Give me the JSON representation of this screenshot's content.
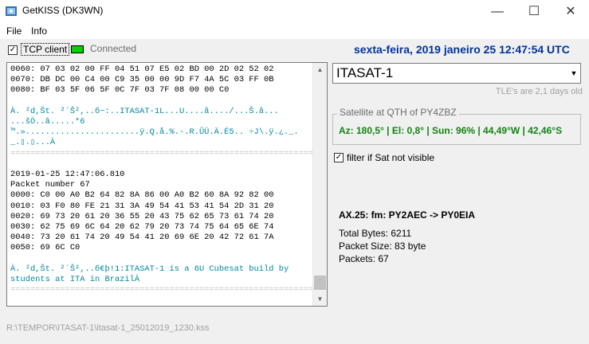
{
  "window": {
    "title": "GetKISS (DK3WN)",
    "minimize": "—",
    "maximize": "☐",
    "close": "✕"
  },
  "menu": {
    "file": "File",
    "info": "Info"
  },
  "connection": {
    "tcp_label": "TCP client",
    "tcp_checked": "✓",
    "status_label": "Connected"
  },
  "clock": "sexta-feira, 2019 janeiro 25  12:47:54 UTC",
  "log": {
    "lines": [
      {
        "t": "0060: 07 03 02 00 FF 04 51 07 E5 02 BD 00 2D 02 52 02",
        "c": ""
      },
      {
        "t": "0070: DB DC 00 C4 00 C9 35 00 00 9D F7 4A 5C 03 FF 0B",
        "c": ""
      },
      {
        "t": "0080: BF 03 5F 06 5F 0C 7F 03 7F 08 00 00 C0",
        "c": ""
      },
      {
        "t": "",
        "c": ""
      },
      {
        "t": "À. ²d,Št. ²`Š²,..б~:..ITASAT-1L...U....â..../...Š.â...",
        "c": "cyan"
      },
      {
        "t": "...šÖ..â.....*6",
        "c": "cyan"
      },
      {
        "t": "™.».......................ÿ.Q.å.%.-.R.ÛÜ.Ä.É5.. ÷J\\.ÿ.¿._.",
        "c": "cyan"
      },
      {
        "t": "_.▯.▯...À",
        "c": "cyan"
      },
      {
        "t": "==================================================================",
        "c": "sep"
      },
      {
        "t": "",
        "c": ""
      },
      {
        "t": "2019-01-25 12:47:06.810",
        "c": ""
      },
      {
        "t": "Packet number 67",
        "c": ""
      },
      {
        "t": "0000: C0 00 A0 B2 64 82 8A 86 00 A0 B2 60 8A 92 82 00",
        "c": ""
      },
      {
        "t": "0010: 03 F0 80 FE 21 31 3A 49 54 41 53 41 54 2D 31 20",
        "c": ""
      },
      {
        "t": "0020: 69 73 20 61 20 36 55 20 43 75 62 65 73 61 74 20",
        "c": ""
      },
      {
        "t": "0030: 62 75 69 6C 64 20 62 79 20 73 74 75 64 65 6E 74",
        "c": ""
      },
      {
        "t": "0040: 73 20 61 74 20 49 54 41 20 69 6E 20 42 72 61 7A",
        "c": ""
      },
      {
        "t": "0050: 69 6C C0",
        "c": ""
      },
      {
        "t": "",
        "c": ""
      },
      {
        "t": "À. ²d,Št. ²`Š²,..б€þ!1:ITASAT-1 is a 6U Cubesat build by",
        "c": "cyan"
      },
      {
        "t": "students at ITA in BrazilÀ",
        "c": "cyan"
      },
      {
        "t": "==================================================================",
        "c": "sep"
      }
    ]
  },
  "satellite": {
    "selected": "ITASAT-1",
    "tle_age": "TLE's are 2,1 days old",
    "qth_title": "Satellite at QTH of PY4ZBZ",
    "qth_values": "Az: 180,5° | El: 0,8° | Sun: 96% | 44,49°W | 42,46°S",
    "filter_label": "filter if Sat not visible",
    "filter_checked": "✓"
  },
  "packet": {
    "ax25": "AX.25: fm: PY2AEC -> PY0EIA",
    "total_bytes": "Total Bytes: 6211",
    "packet_size": "Packet Size: 83 byte",
    "packets": "Packets: 67"
  },
  "status": {
    "path": "R:\\TEMPOR\\ITASAT-1\\itasat-1_25012019_1230.kss"
  },
  "colors": {
    "accent": "#0033a0",
    "satellite_info": "#118411",
    "log_cyan": "#0088a0",
    "led": "#00d200"
  }
}
